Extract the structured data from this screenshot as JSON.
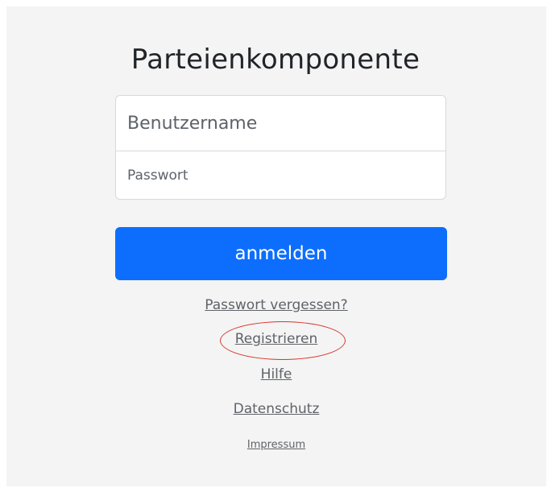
{
  "login": {
    "title": "Parteienkomponente",
    "username_placeholder": "Benutzername",
    "password_placeholder": "Passwort",
    "submit_label": "anmelden"
  },
  "links": {
    "forgot_password": "Passwort vergessen?",
    "register": "Registrieren",
    "help": "Hilfe",
    "privacy": "Datenschutz",
    "imprint": "Impressum"
  },
  "colors": {
    "background": "#f4f4f4",
    "primary_button": "#0d6efd",
    "annotation_circle": "#d9342b"
  }
}
